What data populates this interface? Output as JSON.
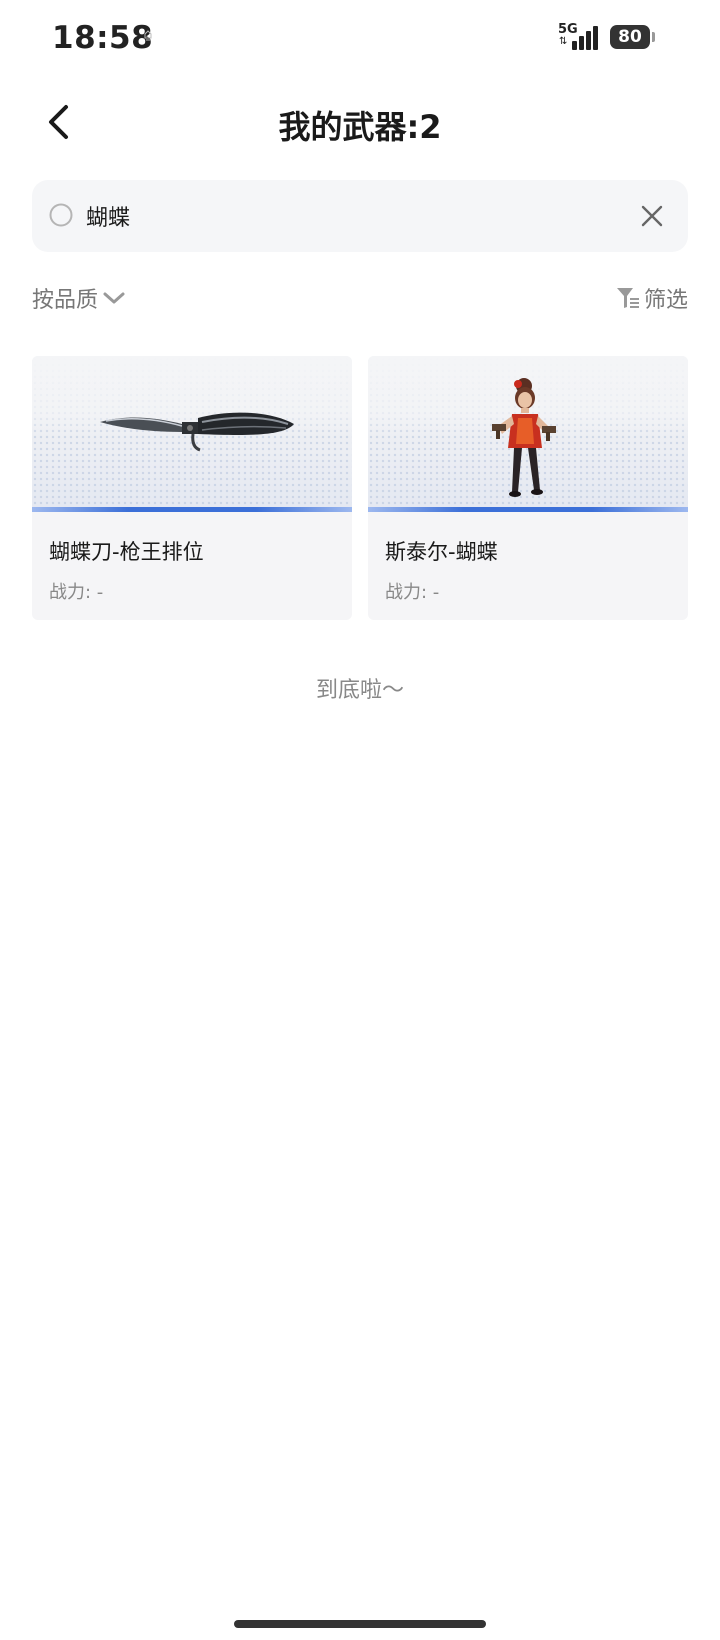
{
  "status_bar": {
    "time": "18:58",
    "network": "5G",
    "battery": "80"
  },
  "header": {
    "title": "我的武器:2",
    "back_icon": "chevron-left-icon"
  },
  "search": {
    "value": "蝴蝶",
    "placeholder": "",
    "search_icon": "search-icon",
    "clear_icon": "close-icon"
  },
  "filters": {
    "sort_label": "按品质",
    "filter_label": "筛选"
  },
  "weapons": [
    {
      "name": "蝴蝶刀-枪王排位",
      "power": "战力: -",
      "image": "butterfly-knife"
    },
    {
      "name": "斯泰尔-蝴蝶",
      "power": "战力: -",
      "image": "character-with-guns"
    }
  ],
  "end_text": "到底啦～",
  "colors": {
    "accent_stripe": "#3b6fd8",
    "card_bg": "#f5f5f7",
    "search_bg": "#f5f6f8"
  }
}
